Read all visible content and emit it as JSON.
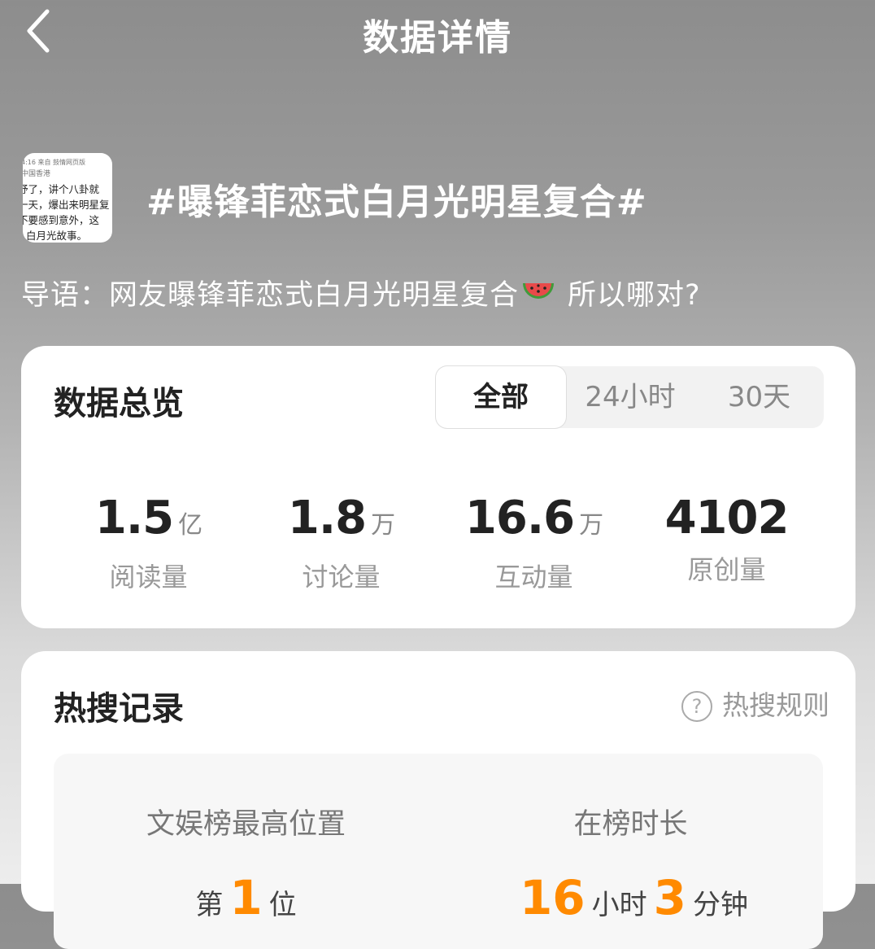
{
  "header": {
    "title": "数据详情",
    "back_icon": "chevron-left-icon"
  },
  "topic": {
    "title": "#曝锋菲恋式白月光明星复合#",
    "guide_prefix": "导语：",
    "guide_text": "网友曝锋菲恋式白月光明星复合",
    "guide_emoji": "watermelon-icon",
    "guide_suffix": "所以哪对?",
    "thumbnail": {
      "meta_line1": "4:16  来自 鼓情网页版",
      "meta_line2": "中国香港",
      "lines": [
        "妤了，讲个八卦就",
        "一天，爆出来明星复",
        "不要感到意外，这",
        "白月光故事。"
      ]
    }
  },
  "overview": {
    "title": "数据总览",
    "tabs": [
      {
        "label": "全部",
        "active": true
      },
      {
        "label": "24小时",
        "active": false
      },
      {
        "label": "30天",
        "active": false
      }
    ],
    "stats": [
      {
        "value": "1.5",
        "unit": "亿",
        "label": "阅读量"
      },
      {
        "value": "1.8",
        "unit": "万",
        "label": "讨论量"
      },
      {
        "value": "16.6",
        "unit": "万",
        "label": "互动量"
      },
      {
        "value": "4102",
        "unit": "",
        "label": "原创量"
      }
    ]
  },
  "hot_search": {
    "title": "热搜记录",
    "rules_label": "热搜规则",
    "best_position": {
      "label": "文娱榜最高位置",
      "prefix": "第",
      "value": "1",
      "suffix": "位"
    },
    "duration": {
      "label": "在榜时长",
      "hours": "16",
      "hours_unit": "小时",
      "minutes": "3",
      "minutes_unit": "分钟"
    }
  },
  "colors": {
    "accent": "#ff8a00",
    "card_bg": "#ffffff",
    "text_dark": "#222222",
    "text_muted": "#999999"
  }
}
